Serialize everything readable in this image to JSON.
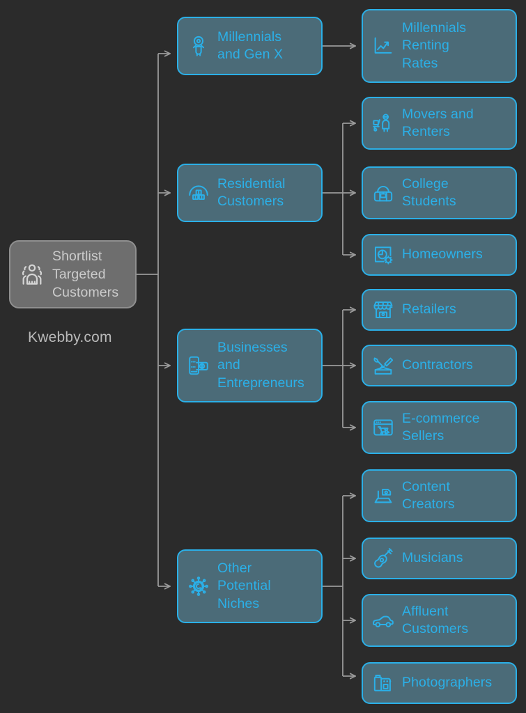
{
  "background_color": "#2b2b2b",
  "palette": {
    "root_fill": "#6e6e6e",
    "root_border": "#8f8f8f",
    "root_text": "#cccccc",
    "node_fill": "#4b6b78",
    "node_border": "#2bb0e8",
    "node_text": "#2bb0e8",
    "connector": "#9a9a9a",
    "watermark_text": "#b9b9b9"
  },
  "watermark": {
    "text": "Kwebby.com"
  },
  "diagram": {
    "type": "tree",
    "orientation": "left-to-right",
    "root": {
      "label": "Shortlist\nTargeted\nCustomers",
      "icon": "group-of-people-icon"
    },
    "branches": [
      {
        "label": "Millennials\nand Gen X",
        "icon": "person-avatar-icon",
        "children": [
          {
            "label": "Millennials\nRenting\nRates",
            "icon": "line-chart-icon"
          }
        ]
      },
      {
        "label": "Residential\nCustomers",
        "icon": "storage-boxes-icon",
        "children": [
          {
            "label": "Movers and\nRenters",
            "icon": "moving-dolly-person-icon"
          },
          {
            "label": "College\nStudents",
            "icon": "backpack-icon"
          },
          {
            "label": "Homeowners",
            "icon": "house-settings-icon"
          }
        ]
      },
      {
        "label": "Businesses\nand\nEntrepreneurs",
        "icon": "mobile-payment-icon",
        "children": [
          {
            "label": "Retailers",
            "icon": "storefront-icon"
          },
          {
            "label": "Contractors",
            "icon": "tools-icon"
          },
          {
            "label": "E-commerce\nSellers",
            "icon": "browser-cart-cursor-icon"
          }
        ]
      },
      {
        "label": "Other\nPotential\nNiches",
        "icon": "niche-network-icon",
        "children": [
          {
            "label": "Content\nCreators",
            "icon": "studio-camera-icon"
          },
          {
            "label": "Musicians",
            "icon": "guitar-icon"
          },
          {
            "label": "Affluent\nCustomers",
            "icon": "sports-car-icon"
          },
          {
            "label": "Photographers",
            "icon": "film-roll-icon"
          }
        ]
      }
    ]
  }
}
